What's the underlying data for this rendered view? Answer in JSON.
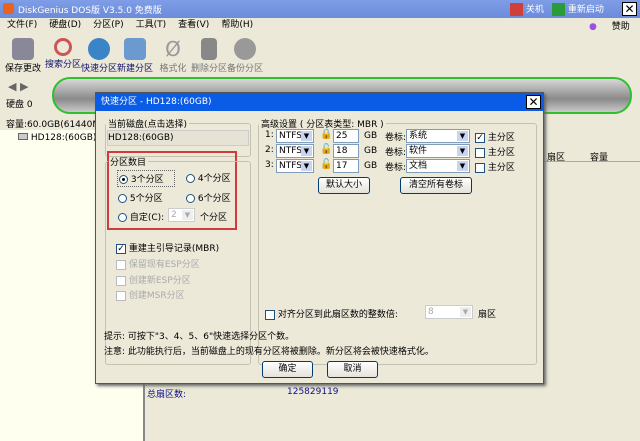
{
  "app": {
    "title": "DiskGenius DOS版 V3.5.0 免费版",
    "shutdown": "关机",
    "restart": "重新启动",
    "sponsor": "赞助"
  },
  "menu": [
    "文件(F)",
    "硬盘(D)",
    "分区(P)",
    "工具(T)",
    "查看(V)",
    "帮助(H)"
  ],
  "toolbar": [
    "保存更改",
    "搜索分区",
    "快速分区",
    "新建分区",
    "格式化",
    "删除分区",
    "备份分区"
  ],
  "left": {
    "disk_label": "硬盘 0",
    "capacity": "容量:60.0GB(61440MB)",
    "tree_item": "HD128:(60GB)"
  },
  "right": {
    "col_sector": "扇区",
    "col_capacity": "容量",
    "total_sectors_label": "总扇区数:",
    "total_sectors_value": "125829119"
  },
  "dialog": {
    "title": "快速分区 - HD128:(60GB)",
    "current_disk_legend": "当前磁盘(点击选择)",
    "current_disk": "HD128:(60GB)",
    "count_legend": "分区数目",
    "options": [
      "3个分区",
      "4个分区",
      "5个分区",
      "6个分区"
    ],
    "selected": "3个分区",
    "custom_label": "自定(C):",
    "custom_value": "2",
    "custom_suffix": "个分区",
    "rebuild_mbr": "重建主引导记录(MBR)",
    "rebuild_mbr_checked": true,
    "keep_esp": "保留现有ESP分区",
    "create_esp": "创建新ESP分区",
    "create_msr": "创建MSR分区",
    "advanced_legend": "高级设置 ( 分区表类型: MBR )",
    "partitions": [
      {
        "index": "1:",
        "fs": "NTFS",
        "locked": true,
        "size": "25",
        "unit": "GB",
        "label_caption": "卷标:",
        "label": "系统",
        "primary": true,
        "primary_label": "主分区"
      },
      {
        "index": "2:",
        "fs": "NTFS",
        "locked": false,
        "size": "18",
        "unit": "GB",
        "label_caption": "卷标:",
        "label": "软件",
        "primary": false,
        "primary_label": "主分区"
      },
      {
        "index": "3:",
        "fs": "NTFS",
        "locked": false,
        "size": "17",
        "unit": "GB",
        "label_caption": "卷标:",
        "label": "文档",
        "primary": false,
        "primary_label": "主分区"
      }
    ],
    "default_size": "默认大小",
    "clear_labels": "清空所有卷标",
    "align_label": "对齐分区到此扇区数的整数倍:",
    "align_value": "8",
    "align_unit": "扇区",
    "tip": "提示: 可按下\"3、4、5、6\"快速选择分区个数。",
    "warning": "注意: 此功能执行后，当前磁盘上的现有分区将被删除。新分区将会被快速格式化。",
    "ok": "确定",
    "cancel": "取消"
  }
}
